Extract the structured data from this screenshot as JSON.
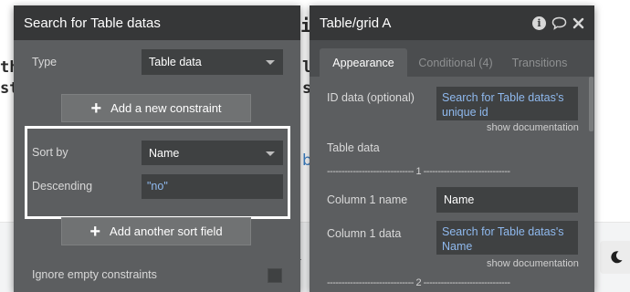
{
  "search_panel": {
    "title": "Search for Table datas",
    "type_label": "Type",
    "type_value": "Table data",
    "add_constraint_label": "Add a new constraint",
    "sort_by_label": "Sort by",
    "sort_by_value": "Name",
    "descending_label": "Descending",
    "descending_value": "\"no\"",
    "add_sort_label": "Add another sort field",
    "ignore_empty_label": "Ignore empty constraints"
  },
  "grid_panel": {
    "title": "Table/grid A",
    "tabs": [
      {
        "label": "Appearance"
      },
      {
        "label": "Conditional (4)"
      },
      {
        "label": "Transitions"
      }
    ],
    "id_data_label": "ID data (optional)",
    "id_data_value": "Search for Table datas's unique id",
    "show_doc_1": "show documentation",
    "table_data_label": "Table data",
    "sep_1": "------------------------------ 1 ------------------------------",
    "col1_name_label": "Column 1 name",
    "col1_name_value": "Name",
    "col1_data_label": "Column 1 data",
    "col1_data_value": "Search for Table datas's Name",
    "show_doc_2": "show documentation",
    "sep_2": "------------------------------ 2 ------------------------------"
  },
  "background": {
    "frag_th": "th",
    "frag_st": "st",
    "frag_i": "i",
    "frag_ld": "ld",
    "frag_st2": "st",
    "frag_b": "b",
    "frag_ti": "ti"
  },
  "colors": {
    "panel": "#5c5e60",
    "header": "#363738",
    "link": "#8fb9ee",
    "highlight": "#ffffff"
  },
  "icons": [
    "plus-icon",
    "info-icon",
    "comment-icon",
    "close-icon",
    "moon-icon",
    "caret-down-icon"
  ]
}
